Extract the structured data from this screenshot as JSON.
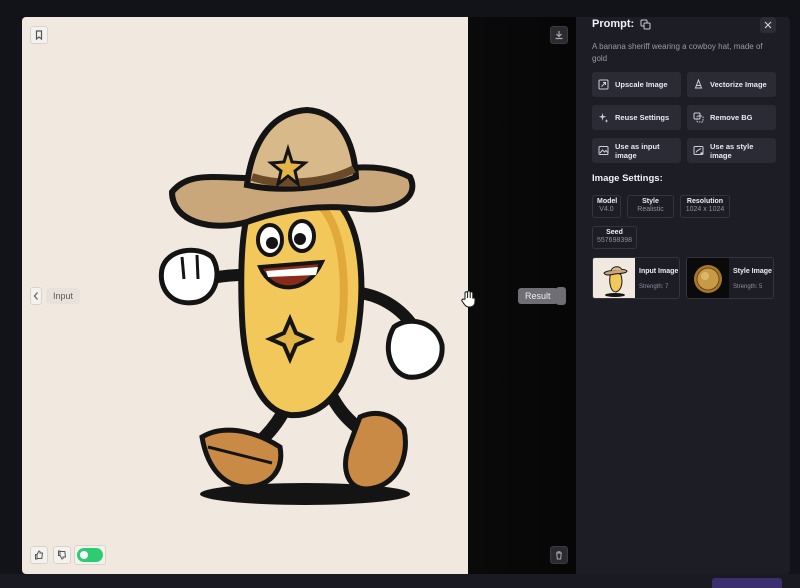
{
  "viewer": {
    "input_label": "Input",
    "result_label": "Result"
  },
  "sidebar": {
    "prompt_title": "Prompt:",
    "prompt_text": "A banana sheriff wearing a cowboy hat, made of gold",
    "actions": [
      {
        "label": "Upscale Image",
        "icon": "upscale-icon"
      },
      {
        "label": "Vectorize Image",
        "icon": "vectorize-icon"
      },
      {
        "label": "Reuse Settings",
        "icon": "sparkle-icon"
      },
      {
        "label": "Remove BG",
        "icon": "remove-bg-icon"
      },
      {
        "label": "Use as input image",
        "icon": "image-input-icon"
      },
      {
        "label": "Use as style image",
        "icon": "image-style-icon"
      }
    ],
    "settings_title": "Image Settings:",
    "settings": {
      "model": {
        "key": "Model",
        "value": "V4.0"
      },
      "style": {
        "key": "Style",
        "value": "Realistic"
      },
      "resolution": {
        "key": "Resolution",
        "value": "1024 x 1024"
      },
      "seed": {
        "key": "Seed",
        "value": "557698398"
      }
    },
    "references": {
      "input": {
        "label": "Input Image",
        "strength": "Strength: 7"
      },
      "style": {
        "label": "Style Image",
        "strength": "Strength: 5"
      }
    }
  },
  "colors": {
    "panel": "#1d1d26",
    "button": "#2b2b36",
    "toggle_on": "#2ecc71",
    "canvas": "#f1e9e0"
  }
}
